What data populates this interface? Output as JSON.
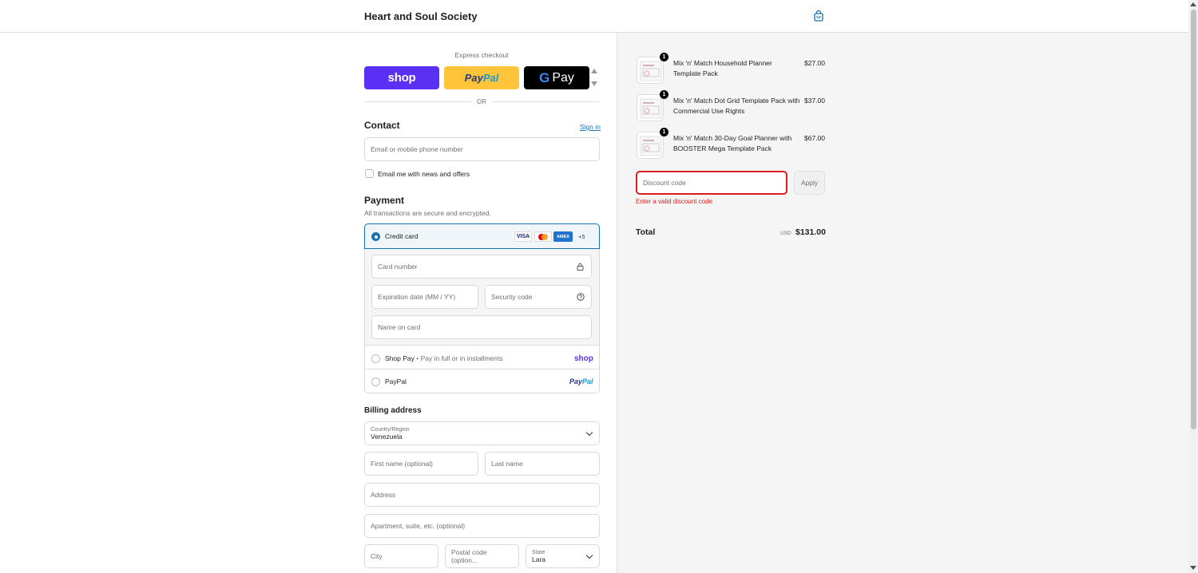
{
  "header": {
    "store_name": "Heart and Soul Society",
    "cart_icon": "shopping-bag-icon"
  },
  "express": {
    "title": "Express checkout",
    "shop_label": "shop",
    "paypal_label_a": "Pay",
    "paypal_label_b": "Pal",
    "gpay_g": "G",
    "gpay_label": "Pay",
    "or_label": "OR"
  },
  "contact": {
    "title": "Contact",
    "sign_in": "Sign in",
    "email_placeholder": "Email or mobile phone number",
    "news_label": "Email me with news and offers"
  },
  "payment": {
    "title": "Payment",
    "subtitle": "All transactions are secure and encrypted.",
    "credit_card_label": "Credit card",
    "card_logos": [
      "VISA",
      "MC",
      "AMEX"
    ],
    "more_cards": "+5",
    "card_number_placeholder": "Card number",
    "expiration_placeholder": "Expiration date (MM / YY)",
    "security_code_placeholder": "Security code",
    "name_on_card_placeholder": "Name on card",
    "shop_pay_label": "Shop Pay",
    "shop_pay_sub": "Pay in full or in installments",
    "shop_pay_logo": "shop",
    "paypal_label": "PayPal",
    "paypal_logo_a": "Pay",
    "paypal_logo_b": "Pal"
  },
  "billing": {
    "title": "Billing address",
    "country_label": "Country/Region",
    "country_value": "Venezuela",
    "first_name_placeholder": "First name (optional)",
    "last_name_placeholder": "Last name",
    "address_placeholder": "Address",
    "apartment_placeholder": "Apartment, suite, etc. (optional)",
    "city_placeholder": "City",
    "postal_placeholder": "Postal code (option...",
    "state_label": "State",
    "state_value": "Lara"
  },
  "summary": {
    "items": [
      {
        "qty": "1",
        "title": "Mix 'n' Match Household Planner Template Pack",
        "price": "$27.00"
      },
      {
        "qty": "1",
        "title": "Mix 'n' Match Dot Grid Template Pack with Commercial Use Rights",
        "price": "$37.00"
      },
      {
        "qty": "1",
        "title": "Mix 'n' Match 30-Day Goal Planner with BOOSTER Mega Template Pack",
        "price": "$67.00"
      }
    ],
    "discount_placeholder": "Discount code",
    "apply_label": "Apply",
    "discount_error": "Enter a valid discount code",
    "total_label": "Total",
    "currency": "USD",
    "total_value": "$131.00"
  },
  "colors": {
    "accent": "#1773b0",
    "shop_purple": "#5a31f4",
    "paypal_yellow": "#ffc439",
    "error": "#dd1d1d"
  }
}
